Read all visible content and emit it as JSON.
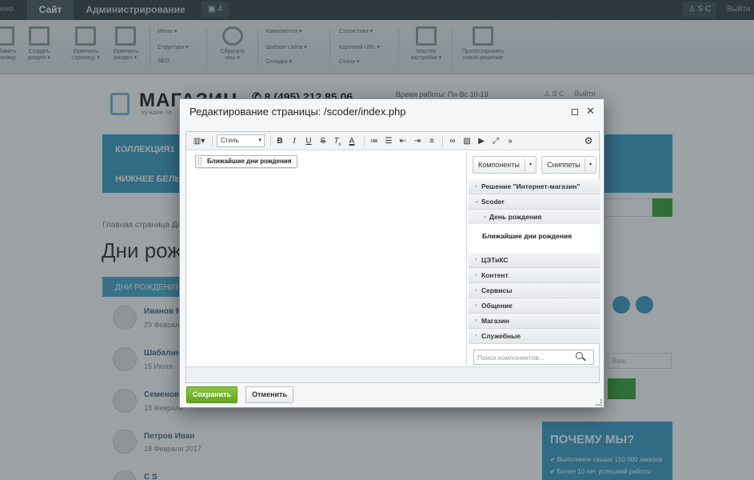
{
  "topbar": {
    "left_cut": "ено",
    "tab_site": "Сайт",
    "tab_admin": "Администрирование",
    "notifications": "4",
    "user": "S C",
    "logout": "Выйти"
  },
  "toolbar": {
    "add": "Добавить\nстраницу",
    "create": "Создать\nраздел ▾",
    "edit_page": "Изменить\nстраницу ▾",
    "edit_section": "Изменить\nраздел ▾",
    "menu": "Меню ▾",
    "structure": "Структура ▾",
    "seo": "SEO",
    "reset_cache": "Сбросить\nкеш ▾",
    "components": "Компоненты ▾",
    "site_template": "Шаблон сайта ▾",
    "debug": "Отладка ▾",
    "stats": "Статистика ▾",
    "short_url": "Короткий URL ▾",
    "styles": "Стили ▾",
    "wizard": "Мастер\nнастройки ▾",
    "test_solution": "Протестировать\nновое решение"
  },
  "site": {
    "logo": "МАГАЗИН",
    "slogan": "лучшие то",
    "phone": "8 (495) 212 85 06",
    "hours": "Время работы: Пн-Вс 10-19",
    "user": "S C",
    "exit": "Выйти",
    "menu_1": "КОЛЛЕКЦИЯ1",
    "menu_2": "НИЖНЕЕ БЕЛЬЕ",
    "crumb": "Главная страница",
    "crumb_sep": "›",
    "crumb_next": "Де",
    "heading": "Дни рожд",
    "tab": "ДНИ РОЖДЕНИЯ",
    "people": [
      {
        "name": "Иванов М",
        "date": "29 Февраля"
      },
      {
        "name": "Шабалин",
        "date": "15 Июля"
      },
      {
        "name": "Семенова",
        "date": "18 Февраля"
      },
      {
        "name": "Петров Иван",
        "date": "18 Февраля 2017"
      },
      {
        "name": "С S",
        "date": ""
      }
    ],
    "why_title": "ПОЧЕМУ МЫ?",
    "why_1": "✔ Выполнили свыше 150 000 заказов",
    "why_2": "✔ Более 10 лет успешной работы",
    "sub_placeholder": "Ваш"
  },
  "dialog": {
    "title": "Редактирование страницы: /scoder/index.php",
    "style_label": "Стиль",
    "component_chip": "Ближайшие дни рождения",
    "btn_components": "Компоненты",
    "btn_snippets": "Сниппеты",
    "tree": [
      {
        "label": "Решение \"Интернет-магазин\"",
        "arrow": "›"
      },
      {
        "label": "Scoder",
        "arrow": "⌄"
      },
      {
        "label": "День рождения",
        "arrow": "⌄"
      },
      {
        "label": "ЦЭТиКС",
        "arrow": "›"
      },
      {
        "label": "Контент",
        "arrow": "›"
      },
      {
        "label": "Сервисы",
        "arrow": "›"
      },
      {
        "label": "Общение",
        "arrow": "›"
      },
      {
        "label": "Магазин",
        "arrow": "›"
      },
      {
        "label": "Служебные",
        "arrow": "›"
      }
    ],
    "tree_leaf": "Ближайшие дни рождения",
    "search_placeholder": "Поиск компонентов...",
    "save": "Сохранить",
    "cancel": "Отменить"
  },
  "colors": {
    "accent": "#3d9fc6",
    "save": "#6aaa24",
    "overlay": "#232f36"
  }
}
